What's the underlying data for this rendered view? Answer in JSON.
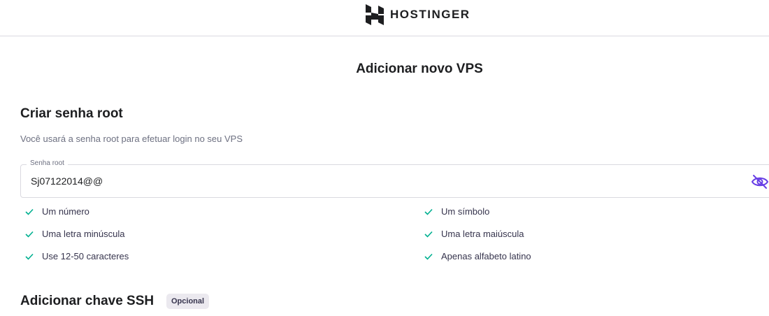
{
  "header": {
    "brand_name": "HOSTINGER",
    "logo_icon": "hostinger-logo-icon"
  },
  "page": {
    "title": "Adicionar novo VPS"
  },
  "root_password": {
    "title": "Criar senha root",
    "description": "Você usará a senha root para efetuar login no seu VPS",
    "field_label": "Senha root",
    "field_value": "Sj07122014@@",
    "toggle_icon": "eye-off-icon",
    "requirements": [
      {
        "label": "Um número",
        "met": true
      },
      {
        "label": "Um símbolo",
        "met": true
      },
      {
        "label": "Uma letra minúscula",
        "met": true
      },
      {
        "label": "Uma letra maiúscula",
        "met": true
      },
      {
        "label": "Use 12-50 caracteres",
        "met": true
      },
      {
        "label": "Apenas alfabeto latino",
        "met": true
      }
    ]
  },
  "ssh": {
    "title": "Adicionar chave SSH",
    "badge": "Opcional"
  },
  "colors": {
    "check": "#00b090",
    "accent": "#673de6",
    "text_dark": "#1d1e20",
    "text_muted": "#6d7081"
  }
}
